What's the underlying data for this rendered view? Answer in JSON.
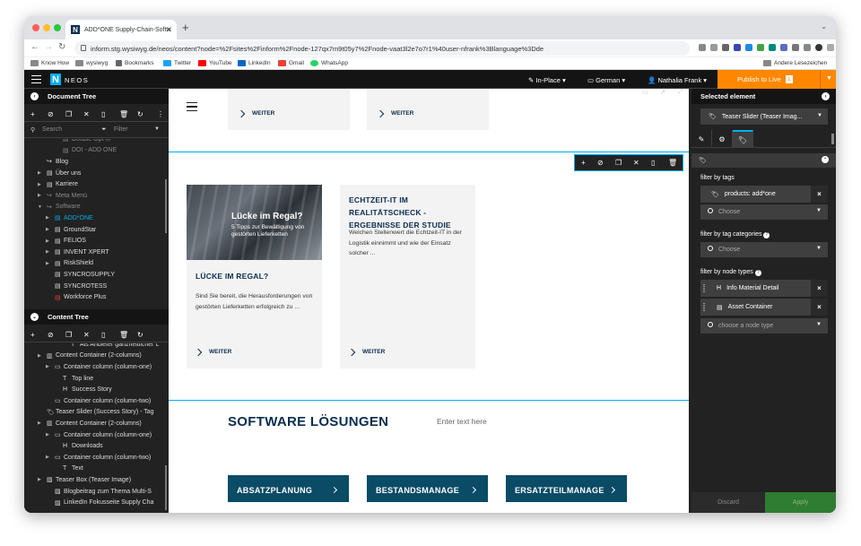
{
  "browser": {
    "tab_title": "ADD*ONE Supply-Chain-Softw",
    "url": "inform.stg.wysiwyg.de/neos/content?node=%2Fsites%2Finform%2Fnode-127qx7m9t05y7%2Fnode-vaat3l2e7o7r1%40user-nfrank%3Blanguage%3Dde",
    "bookmarks": [
      "Know How",
      "wysiwyg",
      "Bookmarks",
      "Twitter",
      "YouTube",
      "LinkedIn",
      "Gmail",
      "WhatsApp"
    ],
    "other_bookmarks": "Andere Lesezeichen"
  },
  "neos": {
    "logo_text": "NEOS",
    "edit_mode": "In-Place",
    "language": "German",
    "user": "Nathalia Frank",
    "publish_label": "Publish to Live",
    "publish_count": "1"
  },
  "document_tree": {
    "title": "Document Tree",
    "search_placeholder": "Search",
    "filter_placeholder": "Filter",
    "items": [
      {
        "label": "Double Opt-In",
        "depth": 3,
        "icon": "file-icon",
        "state": "dim"
      },
      {
        "label": "DOI - ADD ONE",
        "depth": 3,
        "icon": "file-icon",
        "state": "dim"
      },
      {
        "label": "Blog",
        "depth": 1,
        "icon": "shortcut-icon",
        "state": ""
      },
      {
        "label": "Über uns",
        "depth": 1,
        "icon": "file-icon",
        "state": "",
        "arrow": true
      },
      {
        "label": "Karriere",
        "depth": 1,
        "icon": "file-icon",
        "state": "",
        "arrow": true
      },
      {
        "label": "Meta Menü",
        "depth": 1,
        "icon": "shortcut-icon",
        "state": "dim",
        "arrow": true
      },
      {
        "label": "Software",
        "depth": 1,
        "icon": "shortcut-icon",
        "state": "dim",
        "arrow": true,
        "open": true
      },
      {
        "label": "ADD*ONE",
        "depth": 2,
        "icon": "file-icon",
        "state": "active",
        "arrow": true
      },
      {
        "label": "GroundStar",
        "depth": 2,
        "icon": "file-icon",
        "state": "",
        "arrow": true
      },
      {
        "label": "FELIOS",
        "depth": 2,
        "icon": "file-icon",
        "state": "",
        "arrow": true
      },
      {
        "label": "INVENT XPERT",
        "depth": 2,
        "icon": "file-icon",
        "state": "",
        "arrow": true
      },
      {
        "label": "RiskShield",
        "depth": 2,
        "icon": "file-icon",
        "state": "",
        "arrow": true
      },
      {
        "label": "SYNCROSUPPLY",
        "depth": 2,
        "icon": "file-icon",
        "state": ""
      },
      {
        "label": "SYNCROTESS",
        "depth": 2,
        "icon": "file-icon",
        "state": ""
      },
      {
        "label": "Workforce Plus",
        "depth": 2,
        "icon": "file-red-icon",
        "state": ""
      }
    ]
  },
  "content_tree": {
    "title": "Content Tree",
    "items": [
      {
        "label": "Als Anbieter ganzheitlicher L",
        "depth": 4,
        "icon": "text-icon",
        "state": ""
      },
      {
        "label": "Content Container (2-columns)",
        "depth": 1,
        "icon": "columns-icon",
        "state": "",
        "arrow": true
      },
      {
        "label": "Container column (column-one)",
        "depth": 2,
        "icon": "folder-icon",
        "state": "",
        "arrow": true
      },
      {
        "label": "Top line",
        "depth": 3,
        "icon": "text-icon",
        "state": ""
      },
      {
        "label": "Success Story",
        "depth": 3,
        "icon": "heading-icon",
        "state": ""
      },
      {
        "label": "Container column (column-two)",
        "depth": 2,
        "icon": "folder-icon",
        "state": ""
      },
      {
        "label": "Teaser Slider (Success Story) - Tag",
        "depth": 1,
        "icon": "tag-icon",
        "state": ""
      },
      {
        "label": "Content Container (2-columns)",
        "depth": 1,
        "icon": "columns-icon",
        "state": "",
        "arrow": true
      },
      {
        "label": "Container column (column-one)",
        "depth": 2,
        "icon": "folder-icon",
        "state": "",
        "arrow": true
      },
      {
        "label": "Downloads",
        "depth": 3,
        "icon": "heading-icon",
        "state": ""
      },
      {
        "label": "Container column (column-two)",
        "depth": 2,
        "icon": "folder-icon",
        "state": "",
        "arrow": true
      },
      {
        "label": "Text",
        "depth": 3,
        "icon": "text-icon",
        "state": ""
      },
      {
        "label": "Teaser Box (Teaser Image)",
        "depth": 1,
        "icon": "image-icon",
        "state": "",
        "arrow": true
      },
      {
        "label": "Blogbeitrag zum Thema Multi-S",
        "depth": 2,
        "icon": "image-icon",
        "state": ""
      },
      {
        "label": "LinkedIn Fokusseite Supply Cha",
        "depth": 2,
        "icon": "image-icon",
        "state": ""
      }
    ]
  },
  "canvas": {
    "top_teasers": [
      {
        "link": "WEITER"
      },
      {
        "link": "WEITER"
      }
    ],
    "cards": [
      {
        "image_title": "Lücke im Regal?",
        "image_subtitle": "5 Tipps zur Bewältigung von gestörten Lieferketten",
        "title": "LÜCKE IM REGAL?",
        "text": "Sind Sie bereit, die Herausforderungen von gestörten Lieferketten erfolgreich zu ...",
        "link": "WEITER"
      },
      {
        "title": "ECHTZEIT-IT IM REALITÄTSCHECK - ERGEBNISSE DER STUDIE",
        "text": "Welchen Stellenwert die Echtzeit-IT in der Logistik einnimmt und wie der Einsatz solcher ...",
        "link": "WEITER"
      }
    ],
    "software_title": "SOFTWARE LÖSUNGEN",
    "enter_text": "Enter text here",
    "software_buttons": [
      "ABSATZPLANUNG",
      "BESTANDSMANAGE",
      "ERSATZTEILMANAGE"
    ]
  },
  "inspector": {
    "title": "Selected element",
    "element_type": "Teaser Slider (Teaser Imag...",
    "filter_tags_label": "filter by tags",
    "tag_value": "products: add*one",
    "choose_placeholder": "Choose",
    "filter_tag_categories_label": "filter by tag categories",
    "filter_node_types_label": "filter by node types",
    "node_types": [
      "Info Material Detail",
      "Asset Container"
    ],
    "node_type_placeholder": "choose a node type",
    "discard_label": "Discard",
    "apply_label": "Apply"
  },
  "colors": {
    "neos_blue": "#00adee",
    "publish_orange": "#ff8700",
    "brand_navy": "#0a2d4f",
    "software_teal": "#0a4b66",
    "apply_green": "#2e7d32"
  }
}
